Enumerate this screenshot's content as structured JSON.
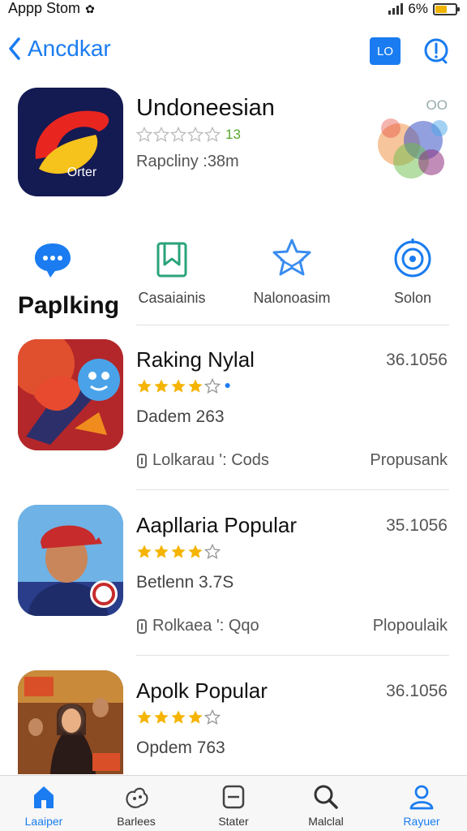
{
  "status_bar": {
    "carrier": "Appp Stom",
    "battery": "6%",
    "battery_level": 0.6
  },
  "nav": {
    "back_label": "Ancdkar",
    "badge_label": "LO"
  },
  "featured": {
    "title": "Undoneesian",
    "rating_badge": "13",
    "subtitle": "Rapcliny :38m",
    "icon_label": "Orter",
    "art_label": "OO",
    "rating": 0
  },
  "categories": [
    {
      "label": "",
      "icon": "chat-bubble-icon"
    },
    {
      "label": "Casaiainis",
      "icon": "bookmark-icon"
    },
    {
      "label": "Nalonoasim",
      "icon": "star-mail-icon"
    },
    {
      "label": "Solon",
      "icon": "target-icon"
    }
  ],
  "section_title": "Paplking",
  "apps": [
    {
      "title": "Raking Nylal",
      "rank": "36.1056",
      "rating": 4,
      "subtitle": "Dadem 263",
      "meta": "Lolkarau ': Cods",
      "tag": "Propusank"
    },
    {
      "title": "Aapllaria Popular",
      "rank": "35.1056",
      "rating": 4,
      "subtitle": "Betlenn 3.7S",
      "meta": "Rolkaea ': Qqo",
      "tag": "Plopoulaik"
    },
    {
      "title": "Apolk Popular",
      "rank": "36.1056",
      "rating": 4,
      "subtitle": "Opdem 763",
      "meta": "",
      "tag": ""
    }
  ],
  "tabs": [
    {
      "label": "Laaiper",
      "icon": "home-icon",
      "active": true
    },
    {
      "label": "Barlees",
      "icon": "games-icon",
      "active": false
    },
    {
      "label": "Stater",
      "icon": "apps-icon",
      "active": false
    },
    {
      "label": "Malclal",
      "icon": "search-icon",
      "active": false
    },
    {
      "label": "Rayuer",
      "icon": "person-icon",
      "active": true
    }
  ],
  "colors": {
    "accent": "#1a7cf0",
    "star": "#f5b400",
    "green": "#58a72f"
  }
}
